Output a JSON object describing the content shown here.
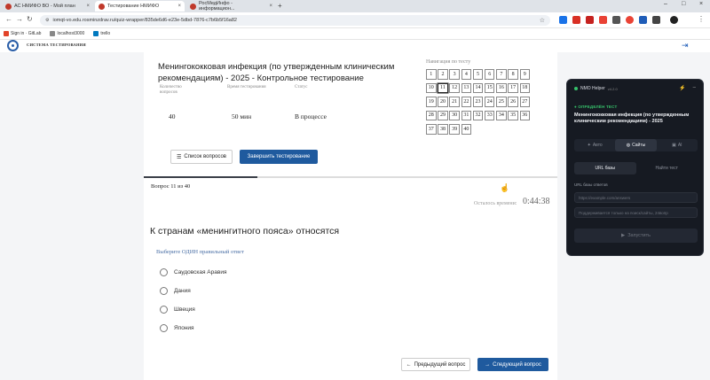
{
  "browser": {
    "tabs": [
      {
        "label": "АС НМИФО ВО - Мой план",
        "active": false
      },
      {
        "label": "Тестирование НМИФО",
        "active": true
      },
      {
        "label": "РосМедИнфо - информацион...",
        "active": false
      }
    ],
    "url": "iomqt-vo.edu.rosminzdrav.ru/quiz-wrapper/835de6d6-e23e-5dbd-7876-c7b6b5f16a82",
    "bookmarks": [
      "Sign in · GitLab",
      "localhost3000",
      "trello"
    ]
  },
  "site": {
    "system_title": "СИСТЕМА ТЕСТИРОВАНИЯ"
  },
  "test": {
    "title": "Менингококковая инфекция (по утвержденным клиническим рекомендациям) - 2025 - Контрольное тестирование",
    "meta": [
      {
        "label": "Количество вопросов",
        "value": "40"
      },
      {
        "label": "Время тестирования",
        "value": "50 мин"
      },
      {
        "label": "Статус",
        "value": "В процессе"
      }
    ],
    "nav_label": "Навигация по тесту",
    "questions": [
      "1",
      "2",
      "3",
      "4",
      "5",
      "6",
      "7",
      "8",
      "9",
      "10",
      "11",
      "12",
      "13",
      "14",
      "15",
      "16",
      "17",
      "18",
      "19",
      "20",
      "21",
      "22",
      "23",
      "24",
      "25",
      "26",
      "27",
      "28",
      "29",
      "30",
      "31",
      "32",
      "33",
      "34",
      "35",
      "36",
      "37",
      "38",
      "39",
      "40"
    ],
    "current_question": 11,
    "list_button": "Список вопросов",
    "finish_button": "Завершить тестирование",
    "progress_fraction": 0.275,
    "counter": "Вопрос 11 из 40",
    "time_left_label": "Осталось времени:",
    "time_left": "0:44:38"
  },
  "question": {
    "text": "К странам «менингитного пояса» относятся",
    "hint": "Выберите ОДИН правильный ответ",
    "options": [
      "Саудовская Аравия",
      "Дания",
      "Швеция",
      "Япония"
    ],
    "prev_button": "Предыдущий вопрос",
    "next_button": "Следующий вопрос"
  },
  "helper": {
    "name": "NMO Helper",
    "version": "v4.2.0",
    "status": "ОПРЕДЕЛЁН ТЕСТ",
    "test_name": "Менингококковая инфекция (по утвержденным клиническим рекомендациям) - 2025",
    "tabs": [
      "Авто",
      "Сайты",
      "AI"
    ],
    "active_tab": "Сайты",
    "subtabs": [
      "URL базы",
      "Найти тест"
    ],
    "field_label": "URL базы ответов",
    "url_placeholder": "https://example.com/answers",
    "hint_placeholder": "Поддерживается только на поиск/сайты, 24вопр",
    "run_button": "Запустить"
  },
  "colors": {
    "primary": "#1f5a9e",
    "helper_bg": "#161a22",
    "status_green": "#36c26b"
  }
}
